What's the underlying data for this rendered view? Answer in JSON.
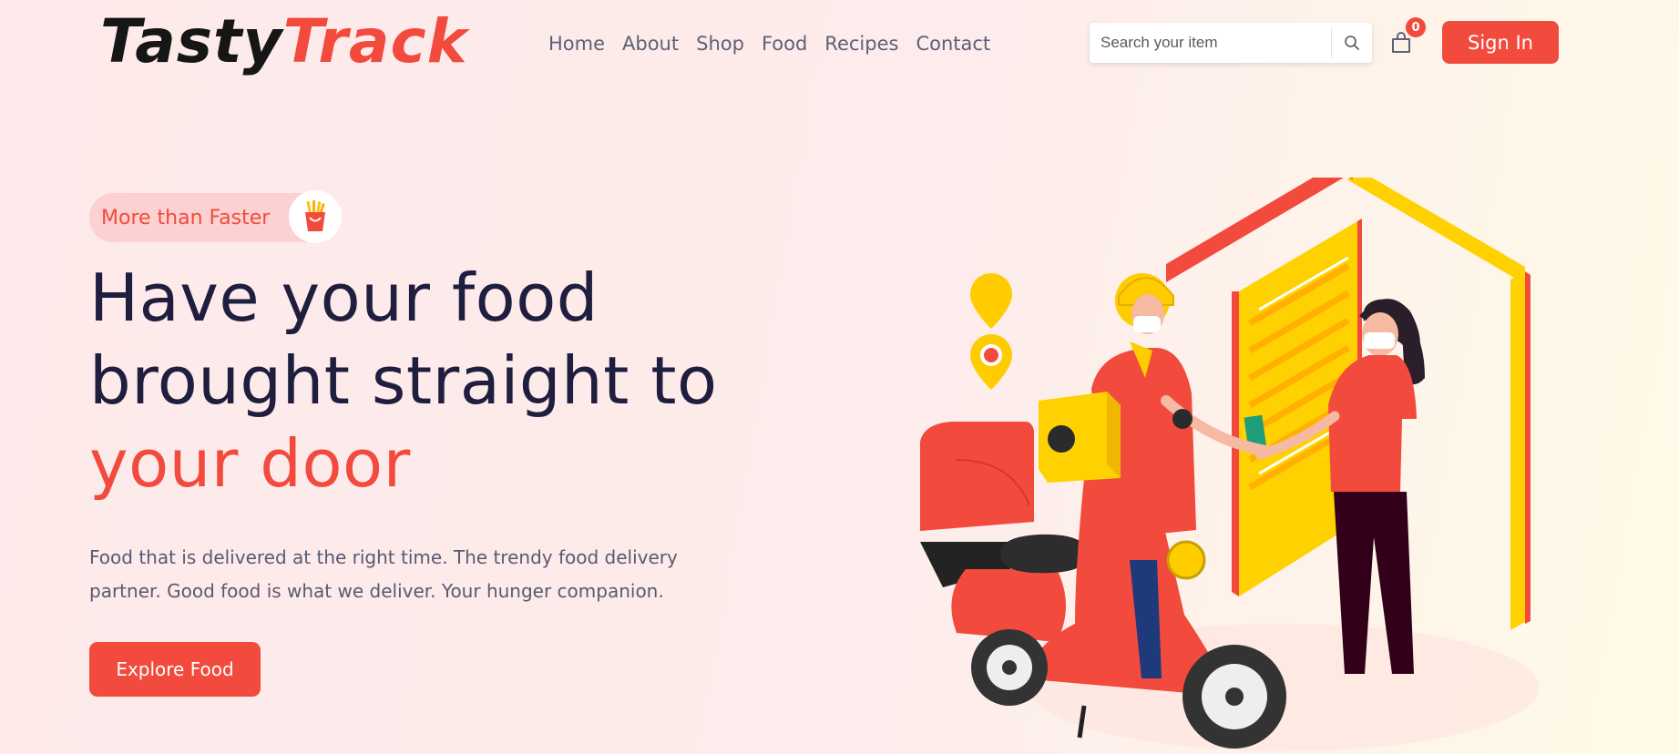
{
  "header": {
    "logo_part1": "Tasty",
    "logo_part2": "Track",
    "nav": [
      "Home",
      "About",
      "Shop",
      "Food",
      "Recipes",
      "Contact"
    ],
    "search_placeholder": "Search your item",
    "search_icon": "search-icon",
    "cart_icon": "shopping-bag-icon",
    "cart_count": "0",
    "signin_label": "Sign In"
  },
  "hero": {
    "tag": "More than Faster",
    "tag_icon": "french-fries-icon",
    "title_line1": "Have your food",
    "title_line2": "brought straight to",
    "title_line3": "your door",
    "description": "Food that is delivered at the right time. The trendy food delivery partner. Good food is what we deliver. Your hunger companion.",
    "cta_label": "Explore Food",
    "illustration": "food-delivery-illustration"
  },
  "colors": {
    "accent": "#f24a3d",
    "heading": "#1f1e3e",
    "text": "#575b70",
    "door_yellow": "#ffd100"
  }
}
